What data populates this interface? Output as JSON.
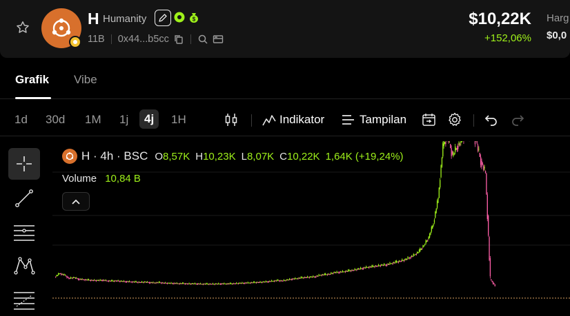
{
  "token": {
    "ticker": "H",
    "name": "Humanity",
    "holders": "11B",
    "address": "0x44...b5cc"
  },
  "price": {
    "value": "$10,22K",
    "change": "+152,06%",
    "label_partial": "Harg",
    "value_partial": "$0,0"
  },
  "tabs": [
    {
      "label": "Grafik",
      "active": true
    },
    {
      "label": "Vibe",
      "active": false
    }
  ],
  "timeframes": [
    {
      "label": "1d",
      "active": false
    },
    {
      "label": "30d",
      "active": false
    },
    {
      "label": "1M",
      "active": false
    },
    {
      "label": "1j",
      "active": false
    },
    {
      "label": "4j",
      "active": true
    },
    {
      "label": "1H",
      "active": false
    }
  ],
  "toolbar": {
    "indicator_label": "Indikator",
    "display_label": "Tampilan"
  },
  "legend": {
    "title": "H · 4h · BSC",
    "open_key": "O",
    "open": "8,57K",
    "high_key": "H",
    "high": "10,23K",
    "low_key": "L",
    "low": "8,07K",
    "close_key": "C",
    "close": "10,22K",
    "change": "1,64K (+19,24%)",
    "volume_label": "Volume",
    "volume": "10,84 B"
  },
  "colors": {
    "up": "#9ef01a",
    "down": "#ff5fa8",
    "accent": "#d8702c",
    "baseline": "#d8a060"
  },
  "chart_data": {
    "type": "line",
    "series": [
      {
        "values": [
          0.3,
          0.45,
          0.38,
          0.25,
          0.28,
          0.22,
          0.2,
          0.18,
          0.17,
          0.16,
          0.18,
          0.15,
          0.14,
          0.15,
          0.13,
          0.12,
          0.11,
          0.1,
          0.09,
          0.1,
          0.08,
          0.07,
          0.08,
          0.06,
          0.05,
          0.05,
          0.04,
          0.04,
          0.03,
          0.03,
          0.03,
          0.02,
          0.02,
          0.02,
          0.02,
          0.03,
          0.03,
          0.03,
          0.04,
          0.05,
          0.06,
          0.07,
          0.08,
          0.09,
          0.1,
          0.12,
          0.14,
          0.16,
          0.15,
          0.18,
          0.22,
          0.24,
          0.27,
          0.29,
          0.3,
          0.32,
          0.38,
          0.4,
          0.42,
          0.48,
          0.5,
          0.52,
          0.55,
          0.58,
          0.62,
          0.66,
          0.7,
          0.72,
          0.75,
          0.78,
          0.8,
          0.85,
          0.9,
          0.95,
          1.0,
          1.1,
          1.2,
          1.35,
          1.6,
          1.9,
          2.5,
          3.5,
          5.6,
          6.0,
          5.2,
          5.6,
          5.8,
          6.2,
          6.0,
          5.8,
          5.0,
          4.5,
          0.2,
          -0.05
        ]
      }
    ]
  }
}
